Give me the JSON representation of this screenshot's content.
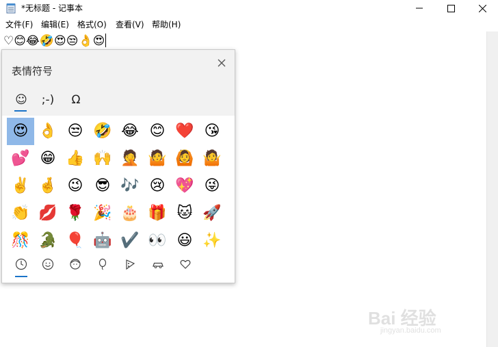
{
  "window": {
    "title": "*无标题 - 记事本"
  },
  "menubar": [
    "文件(F)",
    "编辑(E)",
    "格式(O)",
    "查看(V)",
    "帮助(H)"
  ],
  "document": {
    "text": "♡😊😂🤣😍😒👌😍"
  },
  "emoji_panel": {
    "title": "表情符号",
    "category_tabs": [
      "☺",
      ";-)",
      "Ω"
    ],
    "grid": [
      [
        "😍",
        "👌",
        "😒",
        "🤣",
        "😂",
        "😊",
        "❤️",
        "😘"
      ],
      [
        "💕",
        "😁",
        "👍",
        "🙌",
        "🤦",
        "🤷",
        "🙆",
        "🤷"
      ],
      [
        "✌️",
        "🤞",
        "😉",
        "😎",
        "🎶",
        "😢",
        "💖",
        "😜"
      ],
      [
        "👏",
        "💋",
        "🌹",
        "🎉",
        "🎂",
        "🎁",
        "🐱",
        "🚀"
      ],
      [
        "🎊",
        "🐊",
        "🎈",
        "🤖",
        "✔️",
        "👀",
        "😃",
        "✨"
      ]
    ],
    "bottom_tabs": [
      "clock-icon",
      "smiley-icon",
      "person-icon",
      "balloon-icon",
      "pizza-icon",
      "car-icon",
      "heart-icon"
    ]
  },
  "watermark": {
    "brand": "Bai 经验",
    "url": "jingyan.baidu.com"
  }
}
